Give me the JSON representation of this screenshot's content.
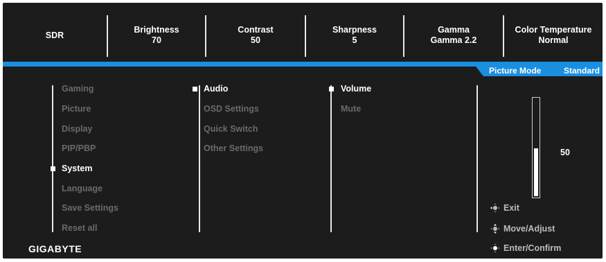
{
  "header": {
    "items": [
      {
        "label": "SDR",
        "value": ""
      },
      {
        "label": "Brightness",
        "value": "70"
      },
      {
        "label": "Contrast",
        "value": "50"
      },
      {
        "label": "Sharpness",
        "value": "5"
      },
      {
        "label": "Gamma",
        "value": "Gamma 2.2"
      },
      {
        "label": "Color Temperature",
        "value": "Normal"
      }
    ]
  },
  "picture_mode": {
    "label": "Picture Mode",
    "value": "Standard"
  },
  "menu1": {
    "items": [
      "Gaming",
      "Picture",
      "Display",
      "PIP/PBP",
      "System",
      "Language",
      "Save Settings",
      "Reset all"
    ],
    "selected_index": 4
  },
  "menu2": {
    "items": [
      "Audio",
      "OSD Settings",
      "Quick Switch",
      "Other Settings"
    ],
    "selected_index": 0
  },
  "menu3": {
    "items": [
      "Volume",
      "Mute"
    ],
    "selected_index": 0
  },
  "volume": {
    "value": "50",
    "level": 50,
    "max": 100
  },
  "guide": {
    "exit": "Exit",
    "move": "Move/Adjust",
    "enter": "Enter/Confirm"
  },
  "brand": "GIGABYTE",
  "colors": {
    "accent": "#1a8fe0",
    "background": "#1c1c1c",
    "selected_text": "#ffffff",
    "inactive_text": "#6a6a6a"
  }
}
